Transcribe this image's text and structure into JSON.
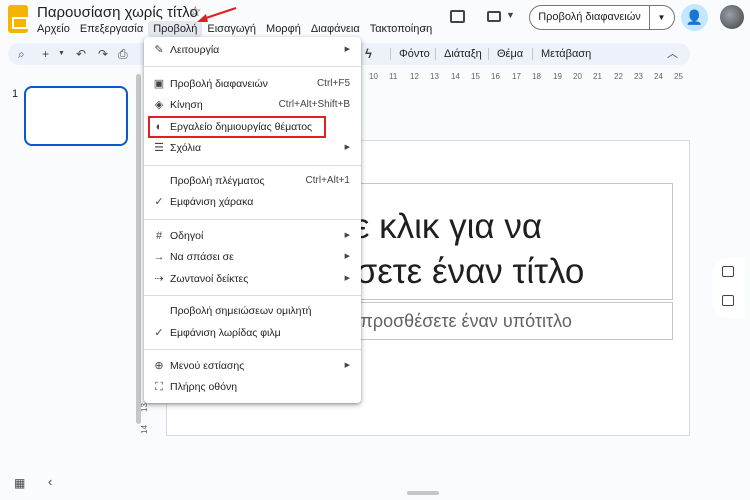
{
  "header": {
    "title": "Παρουσίαση χωρίς τίτλο",
    "star_icon": "star-icon",
    "menus": [
      "Αρχείο",
      "Επεξεργασία",
      "Προβολή",
      "Εισαγωγή",
      "Μορφή",
      "Διαφάνεια",
      "Τακτοποίηση"
    ],
    "active_menu": "Προβολή",
    "slideshow_label": "Προβολή διαφανειών"
  },
  "toolbar": {
    "font_label": "Φόντο",
    "layout_label": "Διάταξη",
    "theme_label": "Θέμα",
    "transition_label": "Μετάβαση"
  },
  "ruler": {
    "ticks": [
      "10",
      "11",
      "12",
      "13",
      "14",
      "15",
      "16",
      "17",
      "18",
      "19",
      "20",
      "21",
      "22",
      "23",
      "24",
      "25"
    ],
    "vertical_ticks": [
      "13",
      "14"
    ]
  },
  "filmstrip": {
    "slide_number": "1"
  },
  "slide": {
    "title_line1": "τε κλικ για να",
    "title_line2": "έσετε έναν τίτλο",
    "subtitle": "να προσθέσετε έναν υπότιτλο"
  },
  "menu": {
    "items": [
      {
        "icon": "pencil-icon",
        "label": "Λειτουργία",
        "shortcut": "",
        "submenu": true
      },
      {
        "icon": "slideshow-icon",
        "label": "Προβολή διαφανειών",
        "shortcut": "Ctrl+F5",
        "submenu": false
      },
      {
        "icon": "motion-icon",
        "label": "Κίνηση",
        "shortcut": "Ctrl+Alt+Shift+B",
        "submenu": false
      },
      {
        "icon": "palette-icon",
        "label": "Εργαλείο δημιουργίας θέματος",
        "shortcut": "",
        "submenu": false
      },
      {
        "icon": "comment-icon",
        "label": "Σχόλια",
        "shortcut": "",
        "submenu": true
      },
      {
        "icon": "",
        "label": "Προβολή πλέγματος",
        "shortcut": "Ctrl+Alt+1",
        "submenu": false
      },
      {
        "icon": "check-icon",
        "label": "Εμφάνιση χάρακα",
        "shortcut": "",
        "submenu": false
      },
      {
        "icon": "grid-guides-icon",
        "label": "Οδηγοί",
        "shortcut": "",
        "submenu": true
      },
      {
        "icon": "snap-icon",
        "label": "Να σπάσει σε",
        "shortcut": "",
        "submenu": true
      },
      {
        "icon": "live-pointer-icon",
        "label": "Ζωντανοί δείκτες",
        "shortcut": "",
        "submenu": true
      },
      {
        "icon": "",
        "label": "Προβολή σημειώσεων ομιλητή",
        "shortcut": "",
        "submenu": false
      },
      {
        "icon": "check-icon",
        "label": "Εμφάνιση λωρίδας φιλμ",
        "shortcut": "",
        "submenu": false
      },
      {
        "icon": "zoom-icon",
        "label": "Μενού εστίασης",
        "shortcut": "",
        "submenu": true
      },
      {
        "icon": "fullscreen-icon",
        "label": "Πλήρης οθόνη",
        "shortcut": "",
        "submenu": false
      }
    ]
  },
  "colors": {
    "accent": "#0b57d0",
    "highlight": "#e02020",
    "logo": "#f4b400"
  }
}
